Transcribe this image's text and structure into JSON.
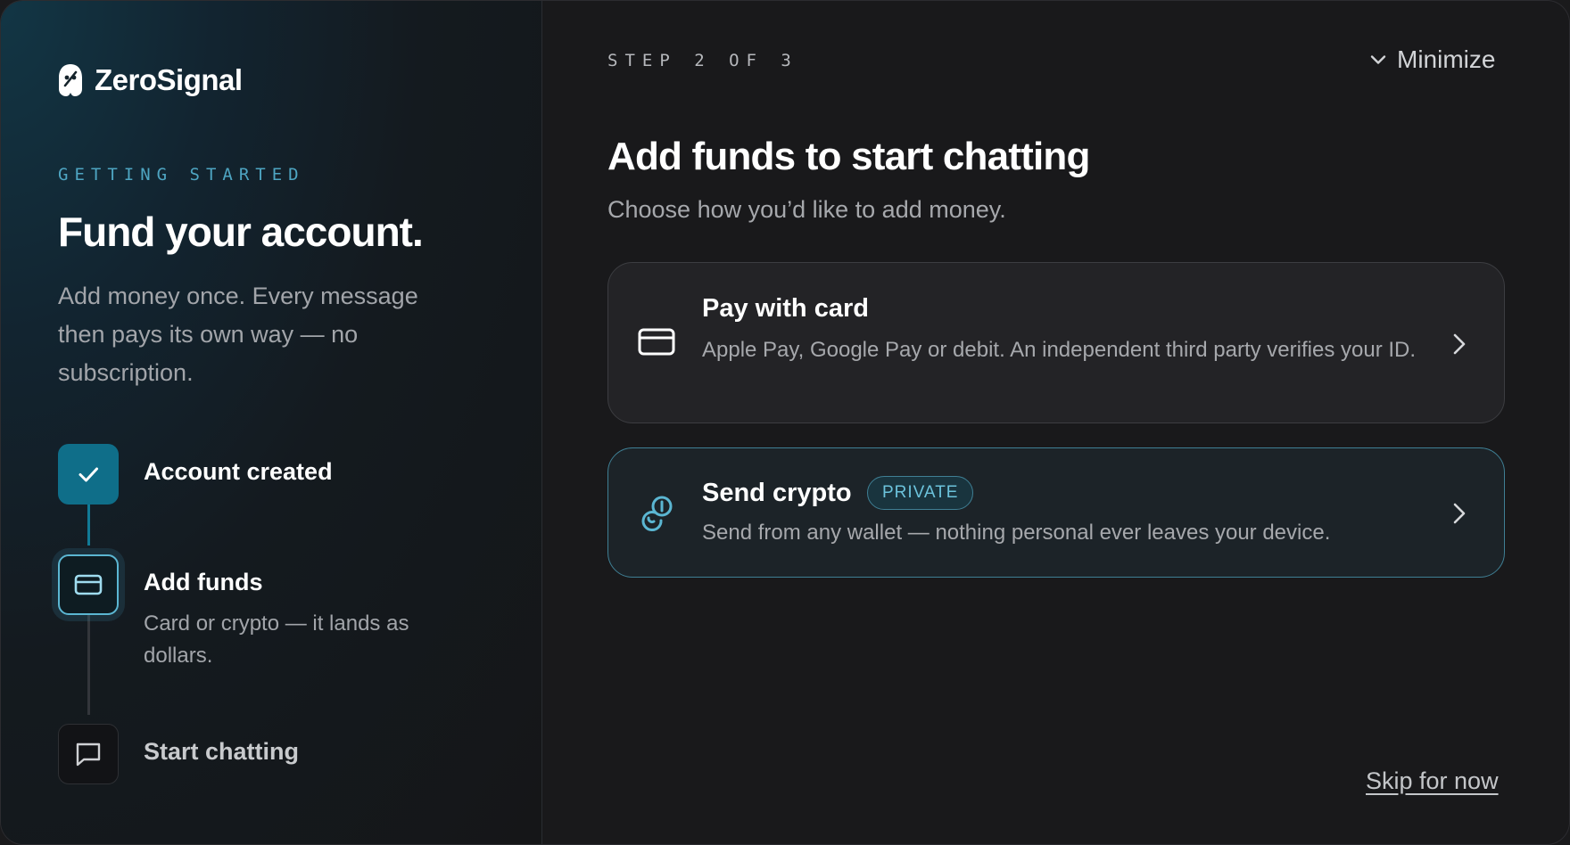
{
  "brand": {
    "name": "ZeroSignal",
    "icon": "zerosignal-logo-icon"
  },
  "left": {
    "eyebrow": "GETTING STARTED",
    "title": "Fund your account.",
    "description": "Add money once. Every message then pays its own way — no subscription.",
    "steps": [
      {
        "title": "Account created",
        "state": "done",
        "icon": "check-icon"
      },
      {
        "title": "Add funds",
        "state": "current",
        "description": "Card or crypto — it lands as dollars.",
        "icon": "credit-card-icon"
      },
      {
        "title": "Start chatting",
        "state": "upcoming",
        "icon": "message-square-icon"
      }
    ]
  },
  "right": {
    "step_counter": "STEP 2 OF 3",
    "minimize_label": "Minimize",
    "title": "Add funds to start chatting",
    "subtitle": "Choose how you’d like to add money.",
    "options": [
      {
        "title": "Pay with card",
        "description": "Apple Pay, Google Pay or debit. An independent third party verifies your ID.",
        "icon": "credit-card-icon"
      },
      {
        "title": "Send crypto",
        "badge": "PRIVATE",
        "description": "Send from any wallet — nothing personal ever leaves your device.",
        "icon": "coins-icon"
      }
    ],
    "skip_label": "Skip for now"
  },
  "colors": {
    "accent": "#5bb6d2",
    "accent_dark": "#0f6e89",
    "badge_text": "#6cc3dc",
    "background": "#19191b"
  }
}
